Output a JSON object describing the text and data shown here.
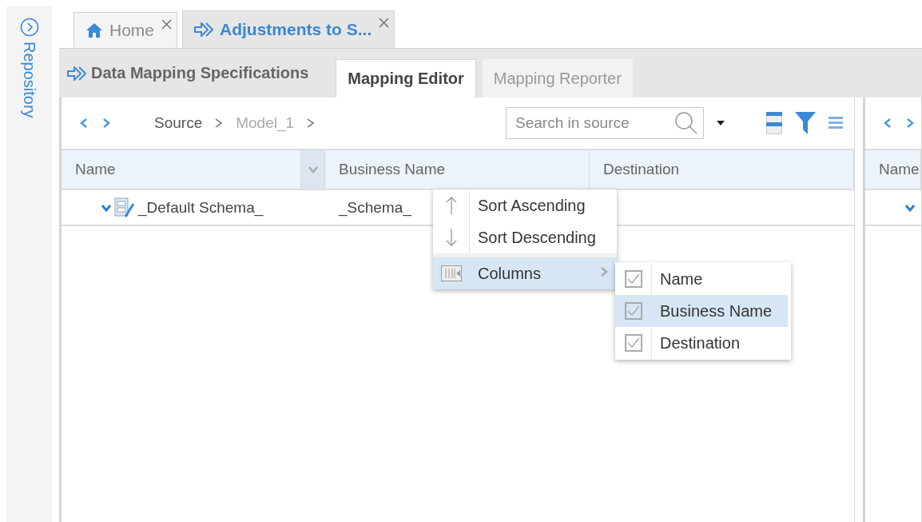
{
  "sidebar": {
    "label": "Repository"
  },
  "tabs": [
    {
      "kind": "home",
      "label": "Home",
      "selected": false
    },
    {
      "kind": "mapping",
      "label": "Adjustments to S...",
      "selected": true
    }
  ],
  "document": {
    "title": "Data Mapping Specifications",
    "tabs": [
      {
        "label": "Mapping Editor",
        "selected": true
      },
      {
        "label": "Mapping Reporter",
        "selected": false
      }
    ]
  },
  "source_panel": {
    "breadcrumb": [
      {
        "label": "Source",
        "current": false
      },
      {
        "label": "Model_1",
        "current": true
      }
    ],
    "search": {
      "placeholder": "Search in source"
    },
    "columns": [
      "Name",
      "Business Name",
      "Destination"
    ],
    "rows": [
      {
        "name": "_Default Schema_",
        "business_name": "_Schema_",
        "expanded": true
      }
    ]
  },
  "target_panel": {
    "columns": [
      "Name"
    ],
    "rows": [
      {
        "expanded": true
      }
    ]
  },
  "column_menu": {
    "items": [
      {
        "kind": "ascending",
        "label": "Sort Ascending"
      },
      {
        "kind": "descending",
        "label": "Sort Descending"
      },
      {
        "kind": "submenu",
        "label": "Columns",
        "selected": true
      }
    ],
    "columns": [
      {
        "label": "Name",
        "checked": true,
        "selected": false
      },
      {
        "label": "Business Name",
        "checked": true,
        "selected": true
      },
      {
        "label": "Destination",
        "checked": true,
        "selected": false
      }
    ]
  }
}
